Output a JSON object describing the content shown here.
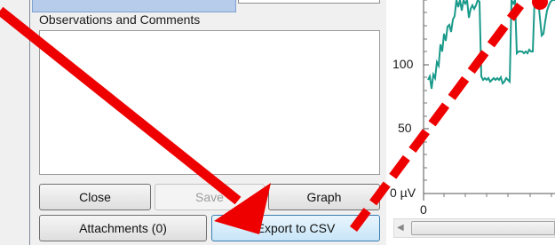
{
  "dialog": {
    "observations_label": "Observations and Comments",
    "observations_value": "",
    "buttons": {
      "close": "Close",
      "save": "Save",
      "graph": "Graph",
      "attachments": "Attachments (0)",
      "export_csv": "Export to CSV"
    }
  },
  "chart": {
    "y_ticks": [
      "100",
      "50",
      "0 µV"
    ],
    "x_ticks": [
      "0"
    ],
    "series_color": "#1a9a8a"
  },
  "annotations": {
    "arrow_color": "#ee0000"
  }
}
